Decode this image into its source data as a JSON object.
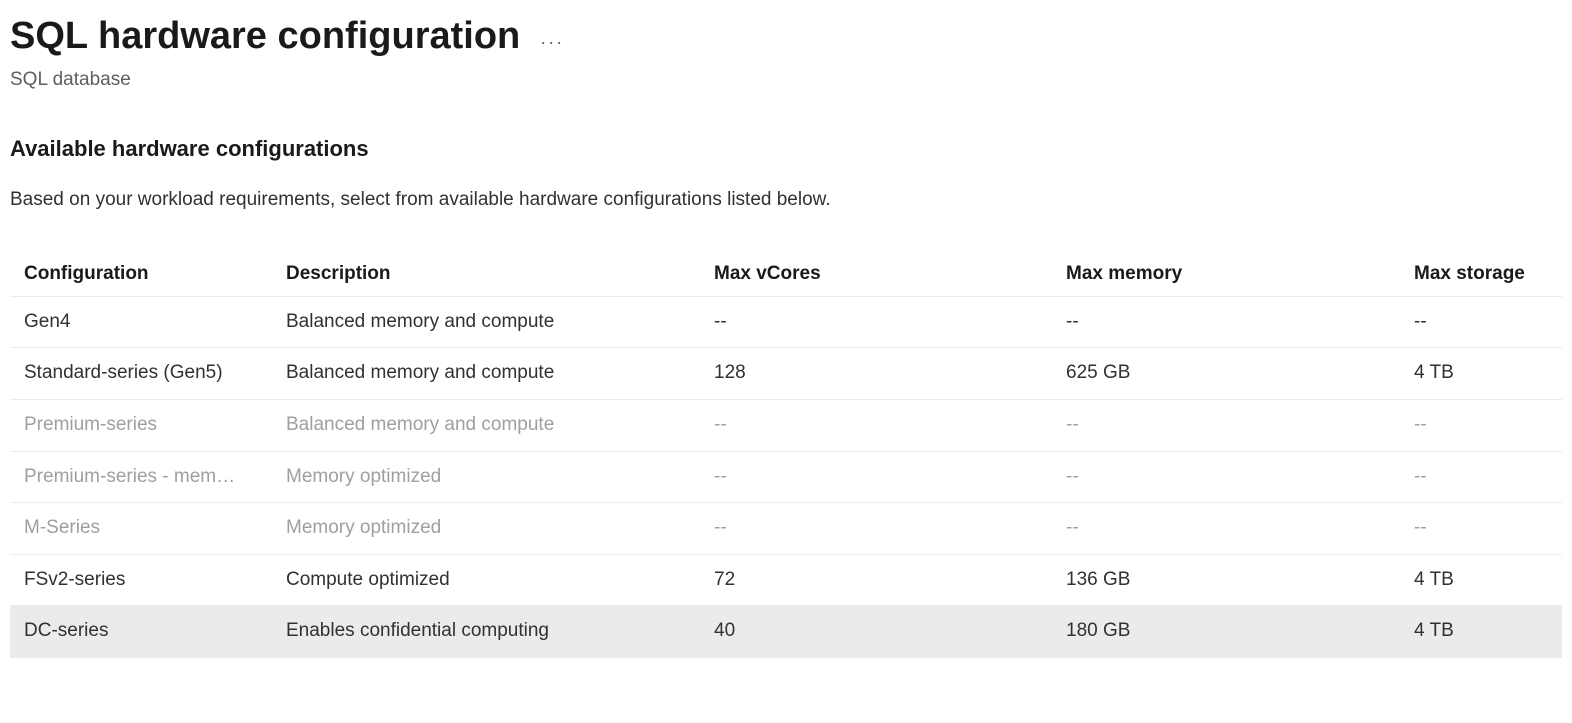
{
  "header": {
    "title": "SQL hardware configuration",
    "subtitle": "SQL database"
  },
  "section": {
    "heading": "Available hardware configurations",
    "description": "Based on your workload requirements, select from available hardware configurations listed below."
  },
  "table": {
    "columns": {
      "config": "Configuration",
      "description": "Description",
      "max_vcores": "Max vCores",
      "max_memory": "Max memory",
      "max_storage": "Max storage"
    },
    "rows": [
      {
        "config": "Gen4",
        "description": "Balanced memory and compute",
        "max_vcores": "--",
        "max_memory": "--",
        "max_storage": "--",
        "disabled": false,
        "selected": false
      },
      {
        "config": "Standard-series (Gen5)",
        "description": "Balanced memory and compute",
        "max_vcores": "128",
        "max_memory": "625 GB",
        "max_storage": "4 TB",
        "disabled": false,
        "selected": false
      },
      {
        "config": "Premium-series",
        "description": "Balanced memory and compute",
        "max_vcores": "--",
        "max_memory": "--",
        "max_storage": "--",
        "disabled": true,
        "selected": false
      },
      {
        "config": "Premium-series - mem…",
        "description": "Memory optimized",
        "max_vcores": "--",
        "max_memory": "--",
        "max_storage": "--",
        "disabled": true,
        "selected": false
      },
      {
        "config": "M-Series",
        "description": "Memory optimized",
        "max_vcores": "--",
        "max_memory": "--",
        "max_storage": "--",
        "disabled": true,
        "selected": false
      },
      {
        "config": "FSv2-series",
        "description": "Compute optimized",
        "max_vcores": "72",
        "max_memory": "136 GB",
        "max_storage": "4 TB",
        "disabled": false,
        "selected": false
      },
      {
        "config": "DC-series",
        "description": "Enables confidential computing",
        "max_vcores": "40",
        "max_memory": "180 GB",
        "max_storage": "4 TB",
        "disabled": false,
        "selected": true
      }
    ]
  }
}
